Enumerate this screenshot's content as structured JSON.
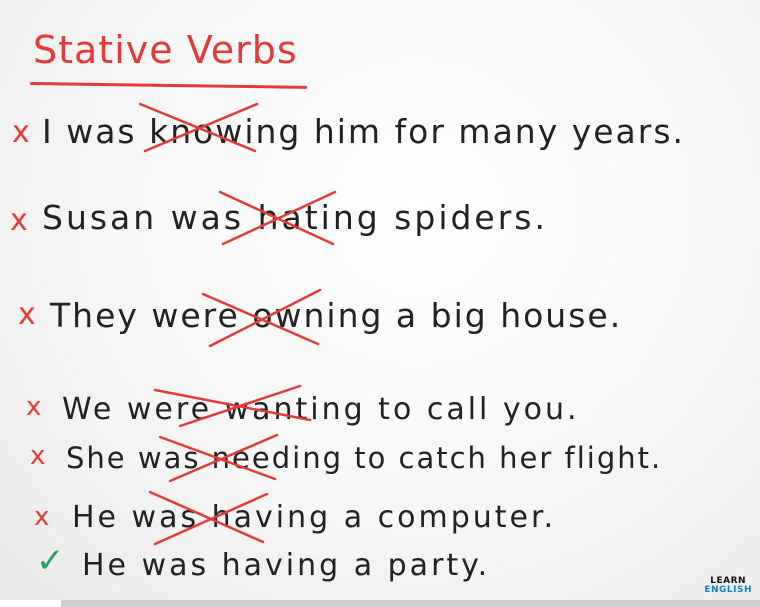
{
  "title": "Stative Verbs",
  "sentences": [
    {
      "mark": "x",
      "text": "I was knowing him for many years."
    },
    {
      "mark": "x",
      "text": "Susan was hating spiders."
    },
    {
      "mark": "x",
      "text": "They were owning a big house."
    },
    {
      "mark": "x",
      "text": "We were wanting to call you."
    },
    {
      "mark": "x",
      "text": "She was needing to catch her flight."
    },
    {
      "mark": "x",
      "text": "He was having a computer."
    },
    {
      "mark": "✓",
      "text": "He was having a party."
    }
  ],
  "branding": {
    "line1": "LEARN",
    "line2": "ENGLISH"
  },
  "video": {
    "progress": 0.08
  },
  "colors": {
    "marker_red": "#e53a3a",
    "marker_black": "#222222",
    "check_green": "#2a9d5f",
    "brand_blue": "#0b84c9"
  }
}
